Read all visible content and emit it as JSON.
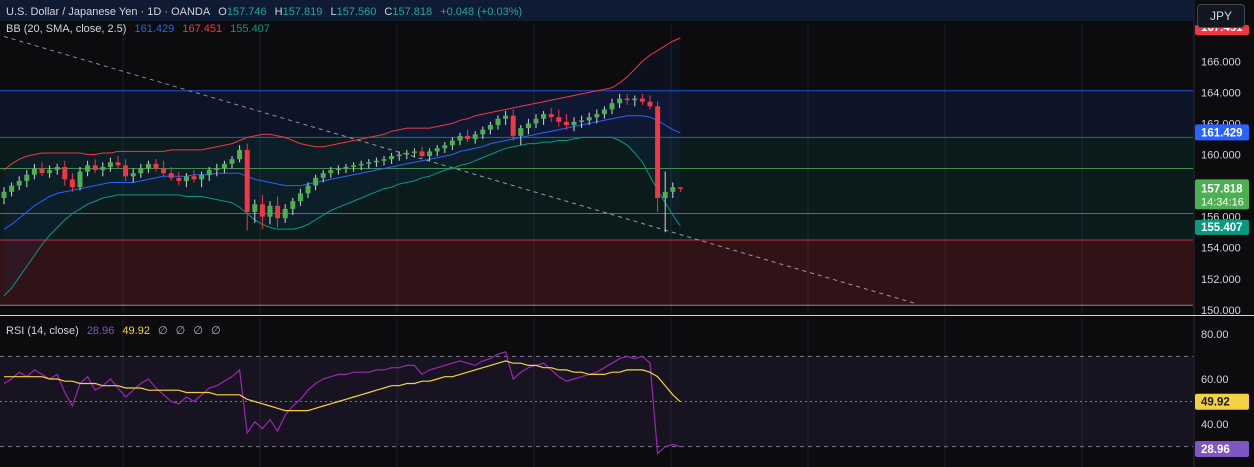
{
  "header": {
    "symbol_title": "U.S. Dollar / Japanese Yen · 1D · OANDA",
    "o_label": "O",
    "o_value": "157.746",
    "h_label": "H",
    "h_value": "157.819",
    "l_label": "L",
    "l_value": "157.560",
    "c_label": "C",
    "c_value": "157.818",
    "change": "+0.048 (+0.03%)",
    "currency_button": "JPY"
  },
  "bb_legend": {
    "label": "BB (20, SMA, close, 2.5)",
    "basis": "161.429",
    "upper": "167.451",
    "lower": "155.407"
  },
  "rsi_legend": {
    "label": "RSI (14, close)",
    "rsi": "28.96",
    "ma": "49.92",
    "extras": [
      "∅",
      "∅",
      "∅",
      "∅"
    ]
  },
  "colors": {
    "up": "#26a69a",
    "down": "#f23645",
    "candle_up": "#4caf50",
    "bb_basis": "#2962ff",
    "bb_upper": "#f23645",
    "bb_lower": "#089981",
    "rsi_line": "#9c27b0",
    "rsi_ma": "#f5d142"
  },
  "price_axis": {
    "ticks": [
      "166.000",
      "164.000",
      "162.000",
      "160.000",
      "156.000",
      "154.000",
      "152.000",
      "150.000"
    ],
    "tick_values": [
      166,
      164,
      162,
      160,
      156,
      154,
      152,
      150
    ],
    "label_partial": "167.451",
    "label_last": "157.818",
    "label_countdown": "14:34:16",
    "label_basis": "161.429",
    "label_lower": "155.407"
  },
  "rsi_axis": {
    "ticks": [
      "80.00",
      "60.00",
      "40.00"
    ],
    "tick_values": [
      80,
      60,
      40
    ],
    "label_ma": "49.92",
    "label_rsi": "28.96"
  },
  "chart_data": [
    {
      "type": "candlestick",
      "title": "U.S. Dollar / Japanese Yen · 1D · OANDA",
      "ylim": [
        149.8,
        168.4
      ],
      "horizontal_levels": [
        164.1,
        161.1,
        159.1,
        156.2,
        154.5
      ],
      "zones": [
        {
          "from": 164.1,
          "to": 161.1,
          "color": "#2962ff"
        },
        {
          "from": 161.1,
          "to": 154.5,
          "color": "#089981"
        },
        {
          "from": 154.5,
          "to": 150.3,
          "color": "#f23645"
        }
      ],
      "trendline": {
        "from": [
          0,
          167.6
        ],
        "to": [
          120,
          150.4
        ]
      },
      "candles": [
        [
          157.2,
          157.9,
          156.8,
          157.6
        ],
        [
          157.6,
          158.2,
          157.3,
          158.0
        ],
        [
          158.0,
          158.6,
          157.7,
          158.3
        ],
        [
          158.3,
          159.0,
          157.9,
          158.7
        ],
        [
          158.7,
          159.4,
          158.4,
          159.1
        ],
        [
          159.1,
          159.5,
          158.6,
          158.8
        ],
        [
          158.8,
          159.3,
          158.5,
          159.0
        ],
        [
          159.0,
          159.4,
          158.7,
          159.2
        ],
        [
          159.2,
          159.6,
          158.0,
          158.4
        ],
        [
          158.4,
          158.8,
          157.6,
          157.9
        ],
        [
          157.9,
          159.2,
          157.7,
          158.9
        ],
        [
          158.9,
          159.6,
          158.6,
          159.3
        ],
        [
          159.3,
          159.7,
          158.8,
          159.0
        ],
        [
          159.0,
          159.5,
          158.6,
          159.2
        ],
        [
          159.2,
          159.8,
          158.9,
          159.5
        ],
        [
          159.5,
          159.9,
          159.1,
          159.3
        ],
        [
          159.3,
          159.7,
          158.3,
          158.6
        ],
        [
          158.6,
          159.1,
          158.2,
          158.8
        ],
        [
          158.8,
          159.4,
          158.5,
          159.1
        ],
        [
          159.1,
          159.6,
          158.8,
          159.4
        ],
        [
          159.4,
          159.7,
          158.9,
          159.1
        ],
        [
          159.1,
          159.6,
          158.6,
          158.8
        ],
        [
          158.8,
          159.2,
          158.3,
          158.5
        ],
        [
          158.5,
          158.9,
          158.0,
          158.3
        ],
        [
          158.3,
          158.8,
          157.9,
          158.6
        ],
        [
          158.6,
          159.0,
          158.2,
          158.4
        ],
        [
          158.4,
          158.9,
          157.9,
          158.7
        ],
        [
          158.7,
          159.2,
          158.3,
          159.0
        ],
        [
          159.0,
          159.4,
          158.6,
          159.1
        ],
        [
          159.1,
          159.6,
          158.8,
          159.4
        ],
        [
          159.4,
          159.9,
          159.1,
          159.7
        ],
        [
          159.7,
          160.6,
          159.5,
          160.3
        ],
        [
          160.3,
          160.7,
          155.1,
          156.3
        ],
        [
          156.3,
          157.1,
          155.6,
          156.8
        ],
        [
          156.8,
          157.4,
          155.2,
          156.0
        ],
        [
          156.0,
          157.0,
          155.5,
          156.7
        ],
        [
          156.7,
          157.3,
          155.3,
          155.9
        ],
        [
          155.9,
          156.8,
          155.6,
          156.5
        ],
        [
          156.5,
          157.2,
          156.1,
          157.0
        ],
        [
          157.0,
          157.8,
          156.7,
          157.5
        ],
        [
          157.5,
          158.2,
          157.2,
          158.0
        ],
        [
          158.0,
          158.7,
          157.7,
          158.5
        ],
        [
          158.5,
          159.0,
          158.2,
          158.8
        ],
        [
          158.8,
          159.2,
          158.5,
          159.0
        ],
        [
          159.0,
          159.3,
          158.7,
          159.1
        ],
        [
          159.1,
          159.4,
          158.8,
          159.2
        ],
        [
          159.2,
          159.5,
          158.9,
          159.3
        ],
        [
          159.3,
          159.6,
          159.0,
          159.4
        ],
        [
          159.4,
          159.7,
          159.1,
          159.5
        ],
        [
          159.5,
          159.8,
          159.2,
          159.6
        ],
        [
          159.6,
          159.9,
          159.3,
          159.7
        ],
        [
          159.7,
          160.1,
          159.4,
          159.9
        ],
        [
          159.9,
          160.2,
          159.6,
          160.0
        ],
        [
          160.0,
          160.3,
          159.7,
          160.1
        ],
        [
          160.1,
          160.4,
          159.8,
          160.2
        ],
        [
          160.2,
          160.5,
          159.8,
          159.9
        ],
        [
          159.9,
          160.4,
          159.6,
          160.2
        ],
        [
          160.2,
          160.6,
          159.9,
          160.4
        ],
        [
          160.4,
          160.8,
          160.1,
          160.6
        ],
        [
          160.6,
          161.1,
          160.3,
          160.9
        ],
        [
          160.9,
          161.4,
          160.6,
          161.2
        ],
        [
          161.2,
          161.6,
          160.8,
          161.0
        ],
        [
          161.0,
          161.5,
          160.7,
          161.3
        ],
        [
          161.3,
          161.8,
          161.0,
          161.6
        ],
        [
          161.6,
          162.1,
          161.3,
          161.9
        ],
        [
          161.9,
          162.5,
          161.6,
          162.3
        ],
        [
          162.3,
          162.8,
          161.9,
          162.5
        ],
        [
          162.5,
          162.9,
          160.9,
          161.2
        ],
        [
          161.2,
          161.9,
          160.6,
          161.7
        ],
        [
          161.7,
          162.3,
          161.3,
          162.0
        ],
        [
          162.0,
          162.6,
          161.7,
          162.3
        ],
        [
          162.3,
          162.8,
          161.9,
          162.6
        ],
        [
          162.6,
          163.0,
          162.1,
          162.4
        ],
        [
          162.4,
          162.9,
          161.8,
          162.1
        ],
        [
          162.1,
          162.6,
          161.6,
          161.9
        ],
        [
          161.9,
          162.4,
          161.5,
          162.1
        ],
        [
          162.1,
          162.5,
          161.7,
          162.2
        ],
        [
          162.2,
          162.7,
          161.9,
          162.4
        ],
        [
          162.4,
          162.9,
          162.0,
          162.6
        ],
        [
          162.6,
          163.1,
          162.3,
          162.9
        ],
        [
          162.9,
          163.6,
          162.6,
          163.3
        ],
        [
          163.3,
          163.9,
          163.0,
          163.6
        ],
        [
          163.6,
          163.9,
          163.2,
          163.5
        ],
        [
          163.5,
          163.8,
          163.1,
          163.6
        ],
        [
          163.6,
          163.9,
          163.2,
          163.4
        ],
        [
          163.4,
          163.8,
          162.9,
          163.1
        ],
        [
          163.1,
          163.4,
          156.3,
          157.2
        ],
        [
          157.2,
          158.9,
          155.0,
          157.6
        ],
        [
          157.6,
          158.2,
          157.2,
          157.9
        ],
        [
          157.9,
          157.9,
          157.6,
          157.8
        ]
      ],
      "bands": {
        "upper": [
          159.0,
          159.4,
          159.7,
          159.9,
          160.0,
          160.1,
          160.1,
          160.1,
          160.1,
          160.1,
          160.1,
          160.0,
          160.0,
          160.1,
          160.1,
          160.2,
          160.2,
          160.2,
          160.2,
          160.2,
          160.2,
          160.2,
          160.3,
          160.3,
          160.3,
          160.3,
          160.3,
          160.4,
          160.5,
          160.6,
          160.7,
          160.9,
          161.1,
          161.2,
          161.3,
          161.3,
          161.2,
          161.1,
          160.9,
          160.7,
          160.6,
          160.5,
          160.5,
          160.6,
          160.7,
          160.8,
          160.9,
          161.0,
          161.1,
          161.2,
          161.3,
          161.5,
          161.6,
          161.7,
          161.7,
          161.7,
          161.7,
          161.8,
          161.9,
          162.0,
          162.2,
          162.3,
          162.5,
          162.6,
          162.7,
          162.8,
          162.9,
          163.0,
          163.1,
          163.2,
          163.3,
          163.4,
          163.5,
          163.6,
          163.7,
          163.8,
          163.9,
          164.0,
          164.1,
          164.2,
          164.3,
          164.6,
          165.0,
          165.5,
          166.0,
          166.4,
          166.7,
          167.0,
          167.3,
          167.5
        ],
        "basis": [
          155.2,
          155.5,
          155.9,
          156.3,
          156.7,
          157.0,
          157.3,
          157.5,
          157.6,
          157.7,
          157.8,
          157.9,
          158.0,
          158.1,
          158.2,
          158.2,
          158.2,
          158.2,
          158.3,
          158.4,
          158.5,
          158.6,
          158.6,
          158.6,
          158.6,
          158.7,
          158.7,
          158.7,
          158.8,
          158.8,
          158.8,
          158.8,
          158.6,
          158.4,
          158.3,
          158.2,
          158.1,
          158.0,
          158.0,
          158.0,
          158.1,
          158.2,
          158.3,
          158.4,
          158.5,
          158.6,
          158.7,
          158.8,
          158.9,
          159.0,
          159.1,
          159.2,
          159.3,
          159.4,
          159.5,
          159.6,
          159.7,
          159.8,
          159.9,
          160.0,
          160.2,
          160.3,
          160.4,
          160.5,
          160.7,
          160.8,
          160.9,
          161.0,
          161.1,
          161.2,
          161.3,
          161.4,
          161.5,
          161.6,
          161.7,
          161.8,
          161.9,
          162.0,
          162.1,
          162.2,
          162.3,
          162.4,
          162.5,
          162.5,
          162.5,
          162.4,
          162.2,
          161.9,
          161.6,
          161.4
        ],
        "lower": [
          150.9,
          151.4,
          152.1,
          152.8,
          153.5,
          154.2,
          154.8,
          155.3,
          155.8,
          156.2,
          156.5,
          156.8,
          157.0,
          157.2,
          157.3,
          157.4,
          157.4,
          157.4,
          157.4,
          157.4,
          157.4,
          157.4,
          157.4,
          157.4,
          157.3,
          157.3,
          157.3,
          157.2,
          157.1,
          157.0,
          156.9,
          156.6,
          156.2,
          155.8,
          155.5,
          155.3,
          155.2,
          155.2,
          155.2,
          155.3,
          155.5,
          155.8,
          156.1,
          156.4,
          156.6,
          156.8,
          157.0,
          157.2,
          157.4,
          157.6,
          157.8,
          157.9,
          158.1,
          158.2,
          158.3,
          158.5,
          158.6,
          158.8,
          159.0,
          159.1,
          159.3,
          159.4,
          159.6,
          159.8,
          160.0,
          160.2,
          160.4,
          160.5,
          160.6,
          160.7,
          160.7,
          160.8,
          160.8,
          160.9,
          160.9,
          161.0,
          161.1,
          161.1,
          161.1,
          161.1,
          161.1,
          160.9,
          160.6,
          160.1,
          159.5,
          158.6,
          157.7,
          156.9,
          156.1,
          155.4
        ]
      }
    },
    {
      "type": "line",
      "title": "RSI (14, close)",
      "ylim": [
        21,
        87
      ],
      "levels": [
        70,
        50,
        30
      ],
      "series": [
        {
          "name": "RSI",
          "values": [
            58,
            60,
            63,
            61,
            64,
            62,
            60,
            62,
            54,
            48,
            58,
            61,
            55,
            57,
            60,
            56,
            52,
            55,
            58,
            60,
            56,
            53,
            50,
            49,
            52,
            50,
            53,
            56,
            57,
            59,
            61,
            64,
            36,
            41,
            38,
            42,
            37,
            44,
            48,
            51,
            55,
            58,
            60,
            61,
            62,
            62,
            63,
            63,
            63,
            64,
            64,
            65,
            65,
            66,
            66,
            62,
            64,
            65,
            66,
            67,
            68,
            67,
            66,
            68,
            69,
            71,
            72,
            60,
            63,
            65,
            66,
            67,
            64,
            61,
            59,
            60,
            61,
            62,
            63,
            65,
            67,
            69,
            70,
            69,
            70,
            67,
            27,
            30,
            31,
            30
          ]
        },
        {
          "name": "MA",
          "values": [
            61,
            61,
            61,
            61,
            61,
            61,
            60,
            60,
            59,
            59,
            58,
            58,
            58,
            57,
            57,
            57,
            56,
            56,
            56,
            55,
            55,
            55,
            55,
            55,
            54,
            54,
            54,
            54,
            53,
            53,
            53,
            53,
            51,
            50,
            49,
            48,
            47,
            46,
            46,
            46,
            46,
            47,
            48,
            49,
            50,
            51,
            52,
            53,
            54,
            55,
            56,
            57,
            57,
            58,
            58,
            59,
            59,
            60,
            61,
            61,
            62,
            63,
            64,
            65,
            66,
            67,
            68,
            67,
            67,
            66,
            66,
            65,
            65,
            64,
            64,
            63,
            63,
            62,
            62,
            62,
            63,
            63,
            64,
            64,
            64,
            63,
            61,
            57,
            53,
            49.9
          ]
        }
      ]
    }
  ]
}
